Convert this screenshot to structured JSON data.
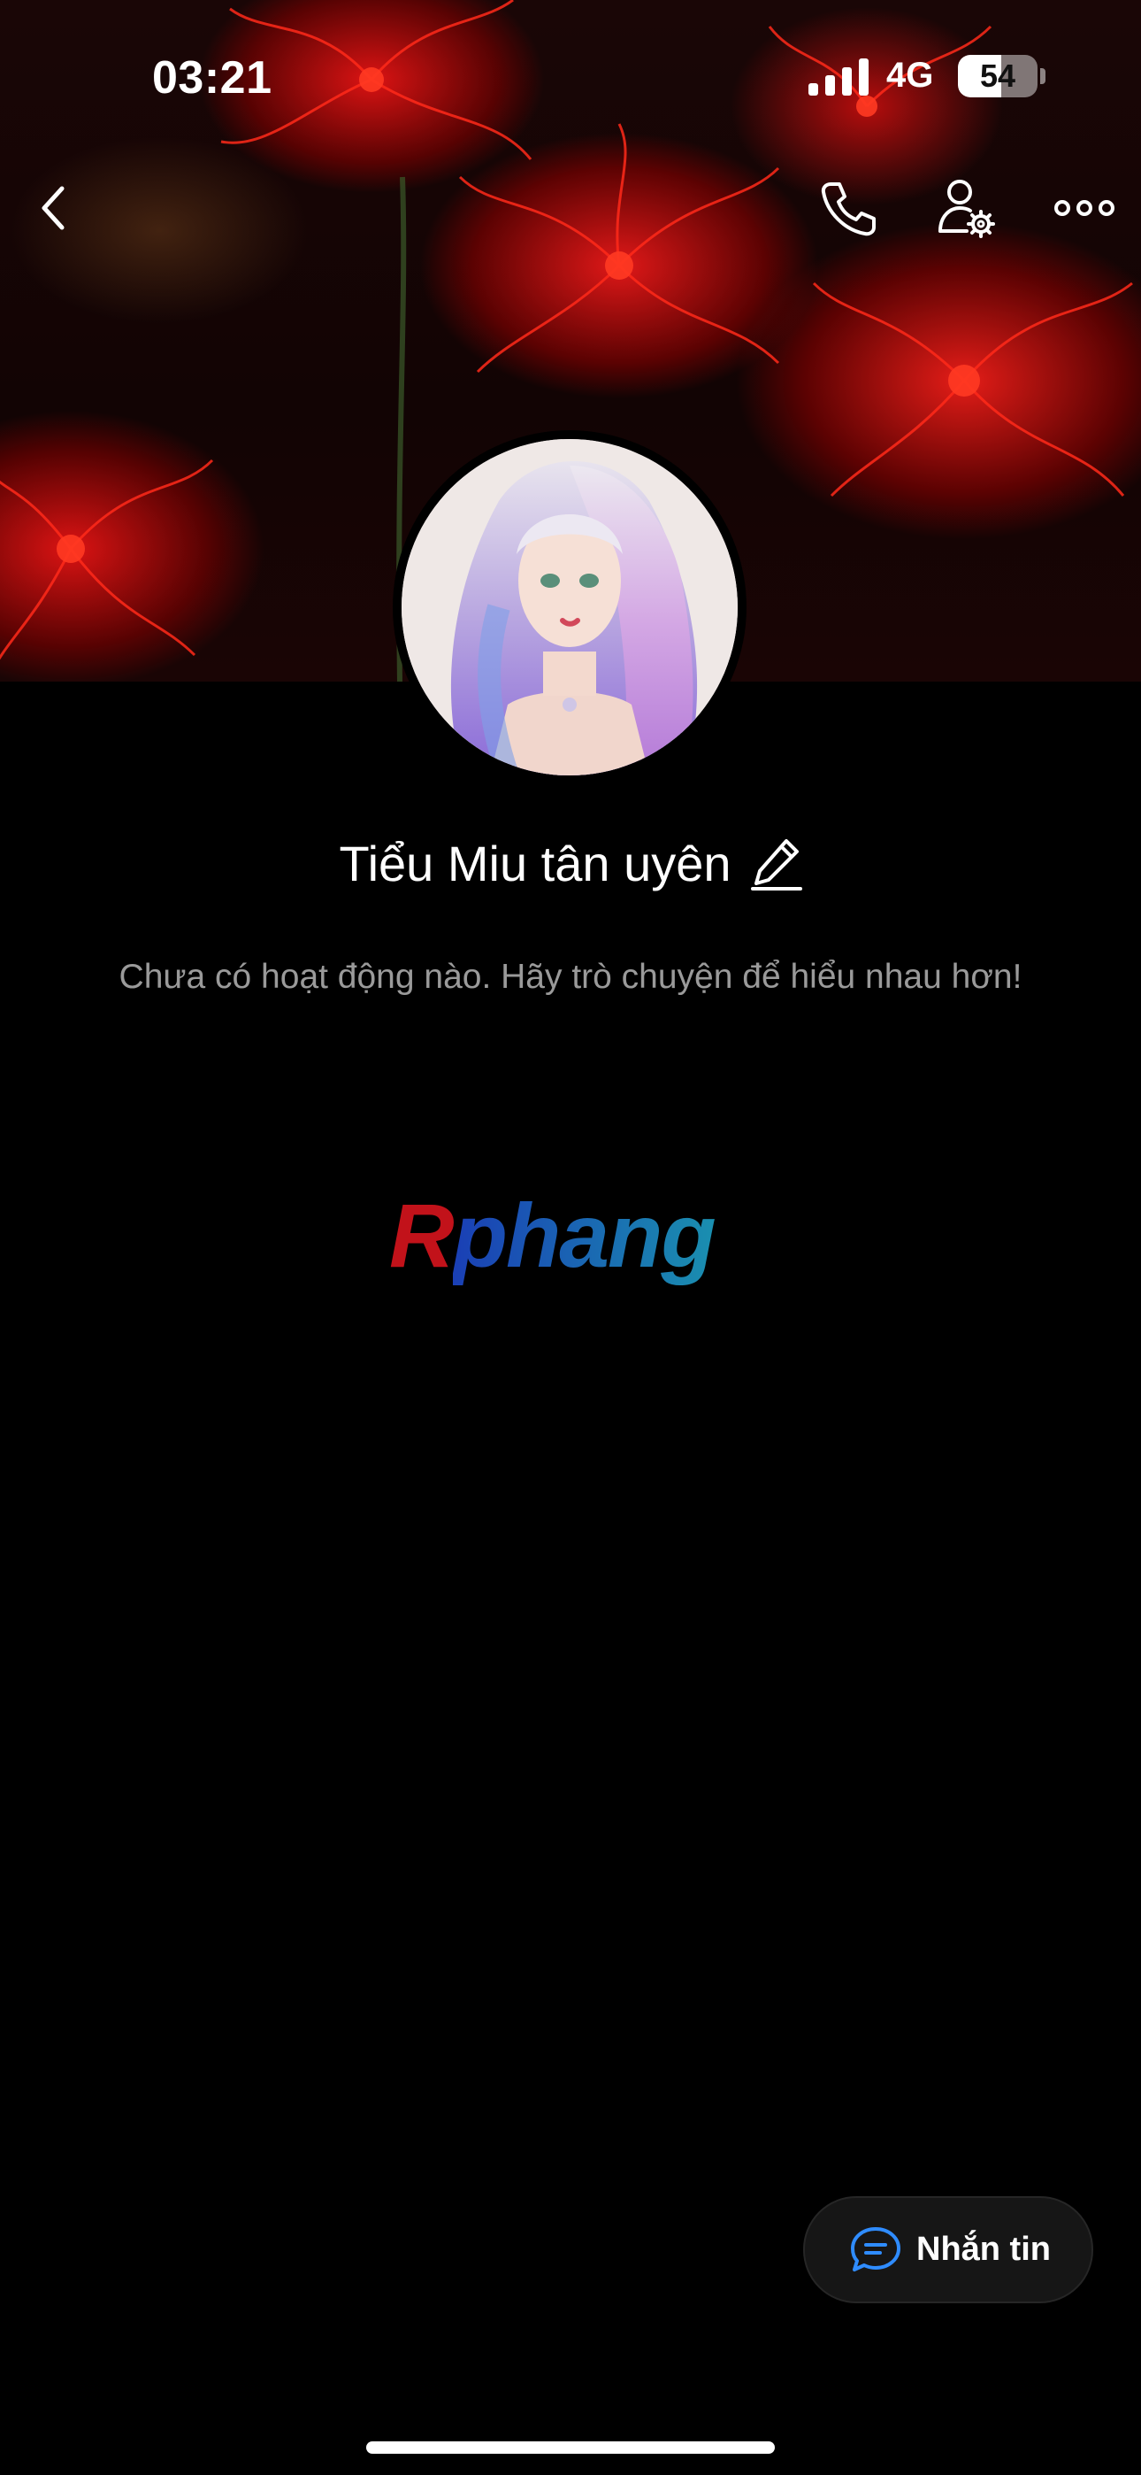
{
  "status_bar": {
    "time": "03:21",
    "network": "4G",
    "battery_level": "54",
    "icons": [
      "signal-icon",
      "battery-icon"
    ]
  },
  "nav": {
    "icons": [
      "back-icon",
      "phone-icon",
      "profile-settings-icon",
      "more-icon"
    ]
  },
  "profile": {
    "name": "Tiểu Miu tân uyên",
    "edit_icon": "pencil-icon",
    "empty_message": "Chưa có hoạt động nào. Hãy trò chuyện để hiểu nhau hơn!"
  },
  "watermark": {
    "text": "Rphang",
    "colors": [
      "#c2121a",
      "#1a3fb5",
      "#1a8fb0"
    ]
  },
  "message_button": {
    "label": "Nhắn tin",
    "icon": "chat-bubble-icon",
    "accent": "#2f8cff"
  }
}
